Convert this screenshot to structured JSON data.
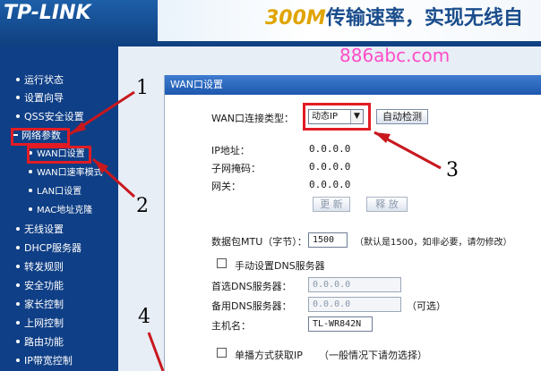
{
  "header": {
    "logo": "TP-LINK",
    "slogan_big": "300M",
    "slogan_rest": "传输速率，实现无线自"
  },
  "watermark": "886abc.com",
  "sidebar": {
    "items": [
      {
        "label": "运行状态"
      },
      {
        "label": "设置向导"
      },
      {
        "label": "QSS安全设置"
      },
      {
        "label": "网络参数"
      },
      {
        "label": "WAN口设置"
      },
      {
        "label": "WAN口速率模式"
      },
      {
        "label": "LAN口设置"
      },
      {
        "label": "MAC地址克隆"
      },
      {
        "label": "无线设置"
      },
      {
        "label": "DHCP服务器"
      },
      {
        "label": "转发规则"
      },
      {
        "label": "安全功能"
      },
      {
        "label": "家长控制"
      },
      {
        "label": "上网控制"
      },
      {
        "label": "路由功能"
      },
      {
        "label": "IP带宽控制"
      }
    ]
  },
  "panel": {
    "title": "WAN口设置",
    "conn_type_label": "WAN口连接类型：",
    "conn_type_value": "动态IP",
    "auto_detect": "自动检测",
    "ip_label": "IP地址：",
    "ip_value": "0.0.0.0",
    "mask_label": "子网掩码：",
    "mask_value": "0.0.0.0",
    "gw_label": "网关：",
    "gw_value": "0.0.0.0",
    "renew": "更 新",
    "release": "释 放",
    "mtu_label": "数据包MTU（字节）：",
    "mtu_value": "1500",
    "mtu_hint": "（默认是1500，如非必要，请勿修改）",
    "manual_dns_label": "手动设置DNS服务器",
    "dns1_label": "首选DNS服务器：",
    "dns1_value": "0.0.0.0",
    "dns2_label": "备用DNS服务器：",
    "dns2_value": "0.0.0.0",
    "dns2_hint": "（可选）",
    "hostname_label": "主机名：",
    "hostname_value": "TL-WR842N",
    "unicast_label": "单播方式获取IP",
    "unicast_hint": "（一般情况下请勿选择）"
  },
  "annotations": {
    "n1": "1",
    "n2": "2",
    "n3": "3",
    "n4": "4"
  }
}
